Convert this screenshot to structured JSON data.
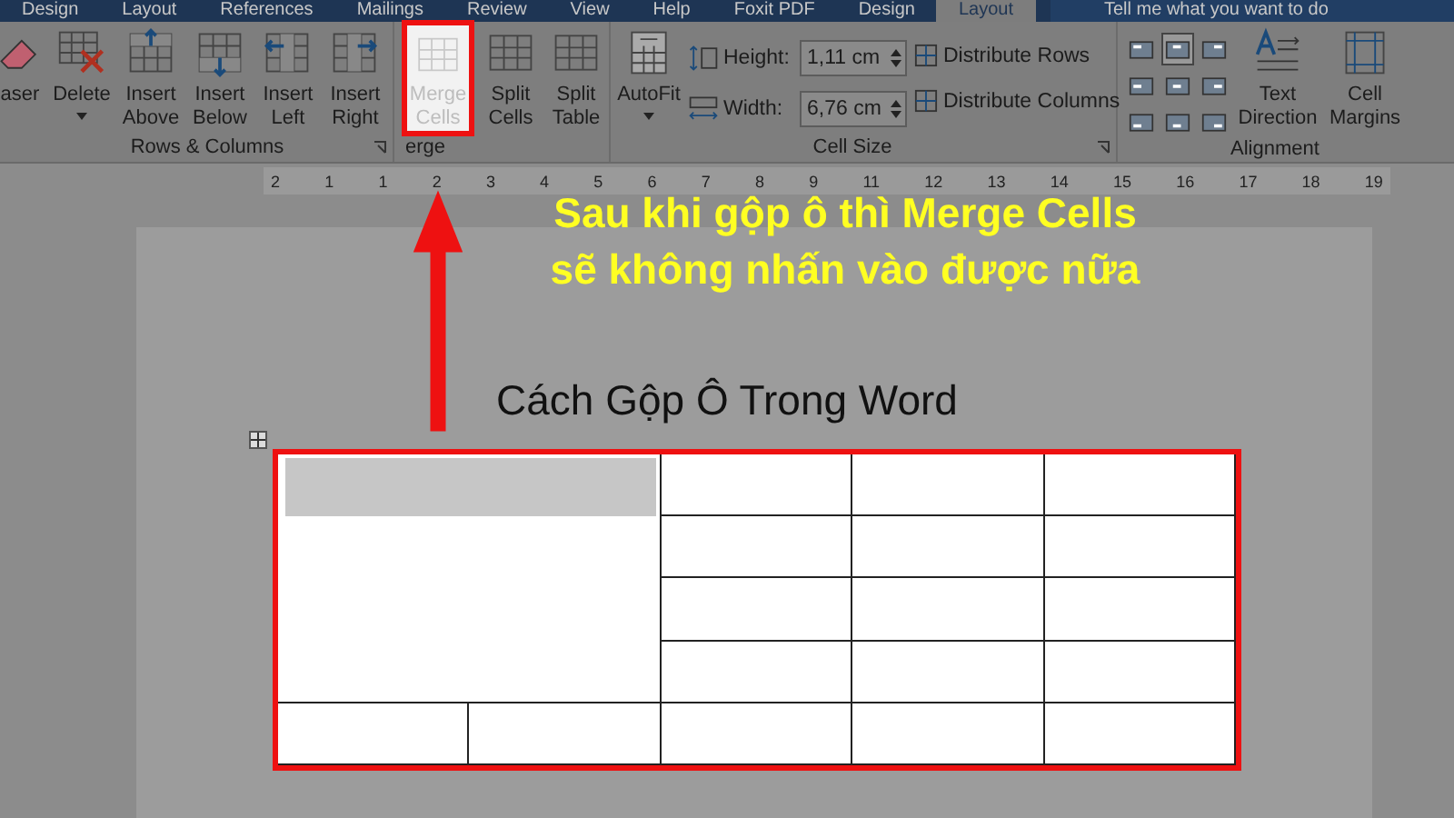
{
  "tabs": [
    {
      "label": "Design",
      "selected": false
    },
    {
      "label": "Layout",
      "selected": false
    },
    {
      "label": "References",
      "selected": false
    },
    {
      "label": "Mailings",
      "selected": false
    },
    {
      "label": "Review",
      "selected": false
    },
    {
      "label": "View",
      "selected": false
    },
    {
      "label": "Help",
      "selected": false
    },
    {
      "label": "Foxit PDF",
      "selected": false
    },
    {
      "label": "Design",
      "selected": false
    },
    {
      "label": "Layout",
      "selected": true
    }
  ],
  "tell_me": {
    "placeholder": "Tell me what you want to do"
  },
  "ribbon": {
    "groups": [
      {
        "items": [
          {
            "kind": "eraser",
            "label": "aser",
            "disabled": false
          }
        ]
      },
      {
        "label": "Rows & Columns",
        "items": [
          {
            "kind": "delete",
            "label": "Delete",
            "disabled": false
          },
          {
            "kind": "above",
            "label": "Insert Above",
            "disabled": false
          },
          {
            "kind": "below",
            "label": "Insert Below",
            "disabled": false
          },
          {
            "kind": "left",
            "label": "Insert Left",
            "disabled": false
          },
          {
            "kind": "right",
            "label": "Insert Right",
            "disabled": false
          }
        ]
      },
      {
        "label": "erge",
        "items": [
          {
            "kind": "merge",
            "label": "Merge Cells",
            "disabled": true
          },
          {
            "kind": "split",
            "label": "Split Cells",
            "disabled": false
          },
          {
            "kind": "splittable",
            "label": "Split Table",
            "disabled": false
          }
        ]
      },
      {
        "label": "Cell Size",
        "items": [
          {
            "kind": "autofit",
            "label": "AutoFit",
            "disabled": false
          },
          {
            "kind": "size",
            "height_label": "Height:",
            "height_value": "1,11 cm",
            "width_label": "Width:",
            "width_value": "6,76 cm"
          },
          {
            "kind": "distribute",
            "rows": "Distribute Rows",
            "columns": "Distribute Columns"
          }
        ]
      },
      {
        "label": "Alignment",
        "items": [
          {
            "kind": "aligngrid",
            "cells": [
              {
                "selected": false
              },
              {
                "selected": true
              },
              {
                "selected": false
              },
              {
                "selected": false
              },
              {
                "selected": false
              },
              {
                "selected": false
              },
              {
                "selected": false
              },
              {
                "selected": false
              },
              {
                "selected": false
              }
            ]
          },
          {
            "kind": "textdir",
            "label": "Text Direction",
            "disabled": false
          },
          {
            "kind": "margins",
            "label": "Cell Margins",
            "disabled": false
          }
        ]
      }
    ]
  },
  "ruler": {
    "labels": [
      "2",
      "1",
      "1",
      "2",
      "3",
      "4",
      "5",
      "6",
      "7",
      "8",
      "9",
      "11",
      "12",
      "13",
      "14",
      "15",
      "16",
      "17",
      "18",
      "19"
    ]
  },
  "annotation": {
    "lines": [
      "Sau khi gộp ô thì Merge Cells",
      "sẽ không nhấn vào được nữa"
    ]
  },
  "document": {
    "heading": "Cách Gộp Ô Trong Word",
    "merged_cell_selected": true
  }
}
